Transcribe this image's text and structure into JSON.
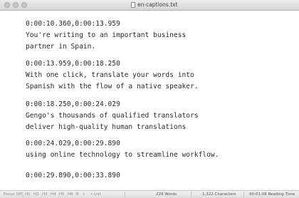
{
  "window": {
    "title": "en-captions.txt"
  },
  "captions": [
    {
      "timing": "0:00:10.360,0:00:13.959",
      "lines": [
        "You're writing to an important business",
        "partner in Spain."
      ]
    },
    {
      "timing": "0:00:13.959,0:00:18.250",
      "lines": [
        "With one click, translate your words into",
        "Spanish with the flow of a native speaker."
      ]
    },
    {
      "timing": "0:00:18.250,0:00:24.029",
      "lines": [
        "Gengo's thousands of qualified translators",
        "deliver high-quality human translations"
      ]
    },
    {
      "timing": "0:00:24.029,0:00:29.890",
      "lines": [
        "using online technology to streamline workflow."
      ]
    },
    {
      "timing": "0:00:29.890,0:00:33.890",
      "lines": []
    }
  ],
  "statusbar": {
    "focus_label": "Focus Off",
    "heading_buttons": [
      "H1",
      "H2",
      "H3",
      "H4",
      "H5",
      "H6",
      "B",
      "I",
      "• List"
    ],
    "word_count": "229 Words",
    "char_count": "1,322 Characters",
    "reading_time": "00:01:08 Reading Time"
  }
}
